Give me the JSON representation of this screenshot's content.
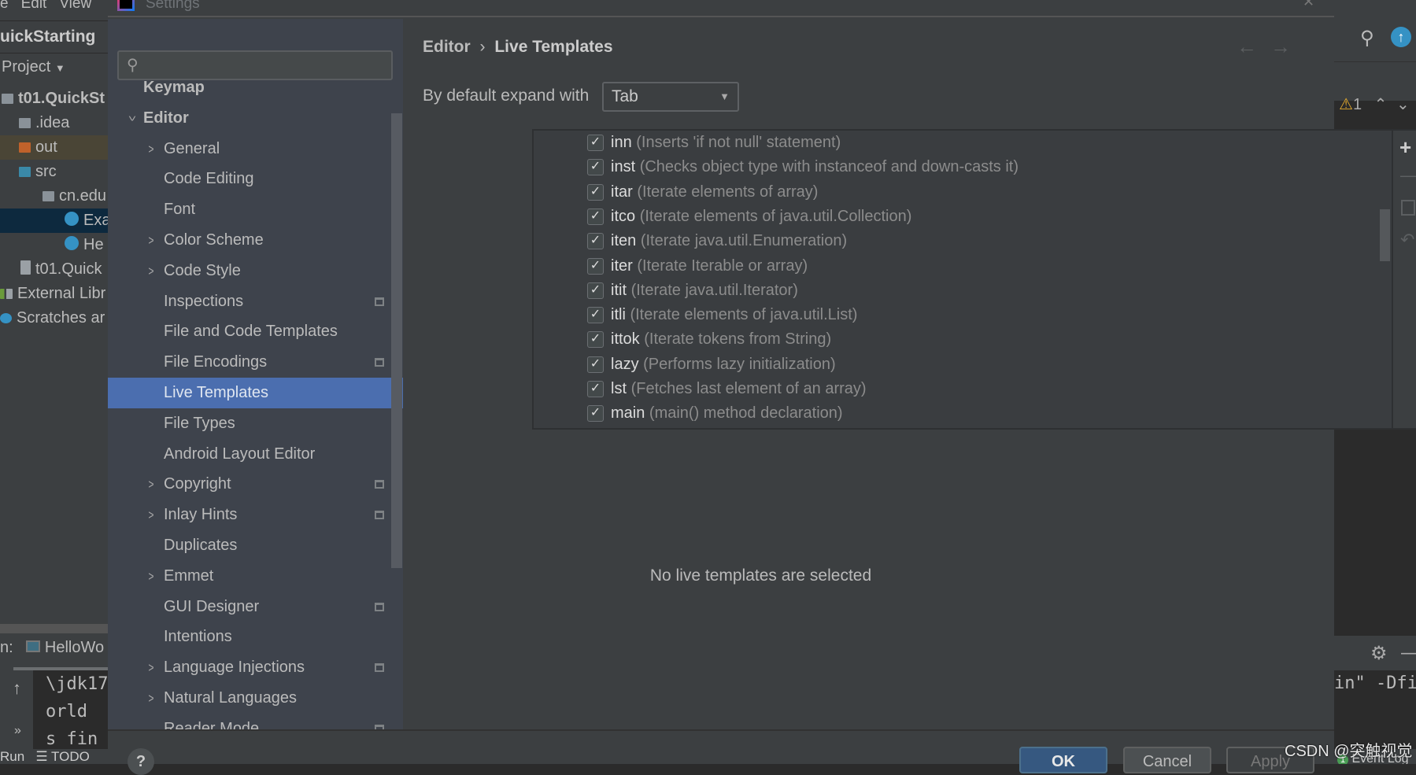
{
  "ide": {
    "menu": [
      "e",
      "Edit",
      "View"
    ],
    "breadcrumb": "uickStarting",
    "project_dropdown": "Project",
    "tree": [
      {
        "label": "t01.QuickSt",
        "icon": "module-folder-icon"
      },
      {
        "label": ".idea",
        "icon": "folder-icon"
      },
      {
        "label": "out",
        "icon": "folder-orange-icon"
      },
      {
        "label": "src",
        "icon": "folder-blue-icon"
      },
      {
        "label": "cn.edu",
        "icon": "package-icon"
      },
      {
        "label": "Exa",
        "icon": "class-icon"
      },
      {
        "label": "He",
        "icon": "class-run-icon"
      },
      {
        "label": "t01.Quick",
        "icon": "iml-file-icon"
      },
      {
        "label": "External Libr",
        "icon": "library-icon"
      },
      {
        "label": "Scratches ar",
        "icon": "scratches-icon"
      }
    ],
    "run_tab": "HelloWo",
    "run_prefix": "n:",
    "console_lines": [
      "\\jdk17",
      "orld",
      "s fin"
    ],
    "bottom_tabs": [
      "Run",
      "TODO"
    ],
    "warning_count": "1",
    "console_right": "in\" -Dfi",
    "event_log": "Event Log",
    "event_log_badge": "1",
    "watermark": "CSDN @突触视觉"
  },
  "dialog": {
    "title": "Settings",
    "search_placeholder": "",
    "sidebar": [
      {
        "label": "Keymap",
        "level": 0,
        "bold": true
      },
      {
        "label": "Editor",
        "level": 0,
        "bold": true,
        "expanded": true
      },
      {
        "label": "General",
        "level": 1,
        "chevron": true
      },
      {
        "label": "Code Editing",
        "level": 1
      },
      {
        "label": "Font",
        "level": 1
      },
      {
        "label": "Color Scheme",
        "level": 1,
        "chevron": true
      },
      {
        "label": "Code Style",
        "level": 1,
        "chevron": true
      },
      {
        "label": "Inspections",
        "level": 1,
        "project": true
      },
      {
        "label": "File and Code Templates",
        "level": 1
      },
      {
        "label": "File Encodings",
        "level": 1,
        "project": true
      },
      {
        "label": "Live Templates",
        "level": 1,
        "selected": true
      },
      {
        "label": "File Types",
        "level": 1
      },
      {
        "label": "Android Layout Editor",
        "level": 1
      },
      {
        "label": "Copyright",
        "level": 1,
        "chevron": true,
        "project": true
      },
      {
        "label": "Inlay Hints",
        "level": 1,
        "chevron": true,
        "project": true
      },
      {
        "label": "Duplicates",
        "level": 1
      },
      {
        "label": "Emmet",
        "level": 1,
        "chevron": true
      },
      {
        "label": "GUI Designer",
        "level": 1,
        "project": true
      },
      {
        "label": "Intentions",
        "level": 1
      },
      {
        "label": "Language Injections",
        "level": 1,
        "chevron": true,
        "project": true
      },
      {
        "label": "Natural Languages",
        "level": 1,
        "chevron": true
      },
      {
        "label": "Reader Mode",
        "level": 1,
        "project": true
      }
    ],
    "breadcrumb": {
      "parent": "Editor",
      "sep": "›",
      "current": "Live Templates"
    },
    "expand_label": "By default expand with",
    "expand_value": "Tab",
    "templates": [
      {
        "key": "inn",
        "desc": "(Inserts 'if not null' statement)",
        "checked": true
      },
      {
        "key": "inst",
        "desc": "(Checks object type with instanceof and down-casts it)",
        "checked": true
      },
      {
        "key": "itar",
        "desc": "(Iterate elements of array)",
        "checked": true
      },
      {
        "key": "itco",
        "desc": "(Iterate elements of java.util.Collection)",
        "checked": true
      },
      {
        "key": "iten",
        "desc": "(Iterate java.util.Enumeration)",
        "checked": true
      },
      {
        "key": "iter",
        "desc": "(Iterate Iterable or array)",
        "checked": true
      },
      {
        "key": "itit",
        "desc": "(Iterate java.util.Iterator)",
        "checked": true
      },
      {
        "key": "itli",
        "desc": "(Iterate elements of java.util.List)",
        "checked": true
      },
      {
        "key": "ittok",
        "desc": "(Iterate tokens from String)",
        "checked": true
      },
      {
        "key": "lazy",
        "desc": "(Performs lazy initialization)",
        "checked": true
      },
      {
        "key": "lst",
        "desc": "(Fetches last element of an array)",
        "checked": true
      },
      {
        "key": "main",
        "desc": "(main() method declaration)",
        "checked": true
      }
    ],
    "empty_message": "No live templates are selected",
    "buttons": {
      "ok": "OK",
      "cancel": "Cancel",
      "apply": "Apply",
      "help": "?"
    },
    "colors": {
      "selection": "#4b6eaf",
      "ok_button": "#365880"
    }
  }
}
